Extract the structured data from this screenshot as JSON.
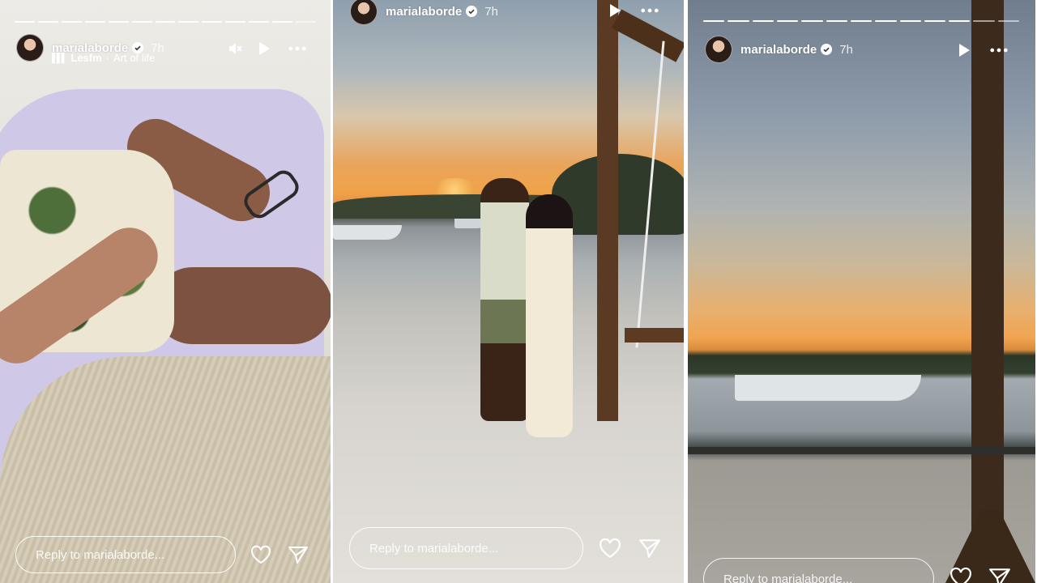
{
  "stories": [
    {
      "username": "marialaborde",
      "time": "7h",
      "music_artist": "Lesfm",
      "music_separator": "·",
      "music_title": "Art of life",
      "reply_placeholder": "Reply to marialaborde...",
      "progress_segments": 13,
      "progress_done": 12
    },
    {
      "username": "marialaborde",
      "time": "7h",
      "reply_placeholder": "Reply to marialaborde..."
    },
    {
      "username": "marialaborde",
      "time": "7h",
      "reply_placeholder": "Reply to marialaborde...",
      "progress_segments": 13,
      "progress_done": 11
    }
  ],
  "icons": {
    "verified": "verified-badge-icon",
    "mute": "speaker-muted-icon",
    "play": "play-icon",
    "more": "more-horizontal-icon",
    "like": "heart-outline-icon",
    "share": "paper-plane-icon"
  },
  "colors": {
    "ui_text": "#ffffff",
    "sunset_orange": "#f0a248"
  }
}
